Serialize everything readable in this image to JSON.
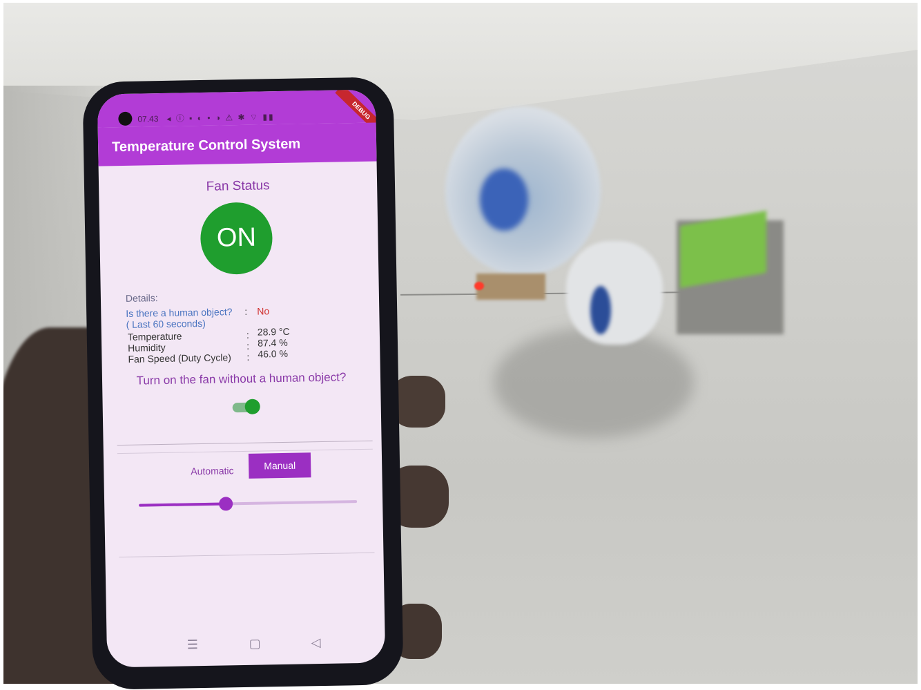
{
  "status_bar": {
    "time": "07.43",
    "icons": "◂ ⓘ ▪ ◐ • ◑ ⚠ ✱ ⌔ ▮▮",
    "debug_label": "DEBUG"
  },
  "app": {
    "title": "Temperature Control System"
  },
  "fan": {
    "status_label": "Fan Status",
    "state": "ON"
  },
  "details": {
    "label": "Details:",
    "human_question": "Is there a human object?",
    "human_colon": ":",
    "human_value": "No",
    "last_seconds": "( Last 60 seconds)",
    "rows": [
      {
        "label": "Temperature",
        "colon": ":",
        "value": "28.9 °C"
      },
      {
        "label": "Humidity",
        "colon": ":",
        "value": "87.4 %"
      },
      {
        "label": "Fan Speed (Duty Cycle)",
        "colon": ":",
        "value": "46.0 %"
      }
    ]
  },
  "toggle": {
    "prompt": "Turn on the fan without a human object?",
    "on": true
  },
  "mode": {
    "automatic_label": "Automatic",
    "manual_label": "Manual",
    "selected": "Manual"
  },
  "slider": {
    "value_fraction": 0.4
  },
  "nav": {
    "menu_icon": "menu-icon",
    "home_icon": "home-icon",
    "back_icon": "back-icon",
    "menu_glyph": "☰",
    "home_glyph": "▢",
    "back_glyph": "◁"
  },
  "colors": {
    "app_bar": "#b23cd6",
    "on_green": "#1f9e2e",
    "accent_purple": "#9b2fc2",
    "warning_red": "#d0302e"
  }
}
